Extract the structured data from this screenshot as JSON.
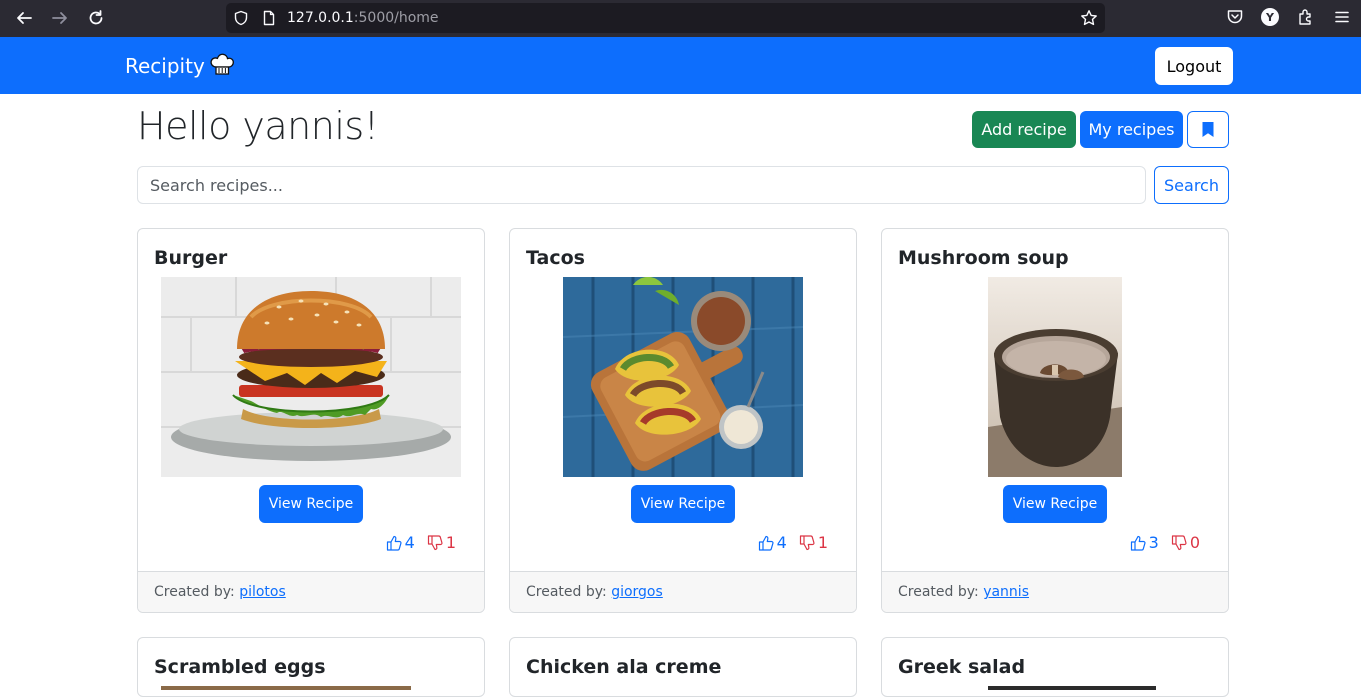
{
  "browser": {
    "url_host": "127.0.0.1",
    "url_path": ":5000/home",
    "profile_initial": "Y"
  },
  "navbar": {
    "brand": "Recipity",
    "logout_label": "Logout"
  },
  "header": {
    "greeting": "Hello yannis!",
    "add_recipe_label": "Add recipe",
    "my_recipes_label": "My recipes",
    "bookmark_icon": "bookmark-icon"
  },
  "search": {
    "placeholder": "Search recipes...",
    "value": "",
    "button_label": "Search"
  },
  "recipes": [
    {
      "title": "Burger",
      "view_label": "View Recipe",
      "likes": "4",
      "dislikes": "1",
      "created_by_label": "Created by:",
      "author": "pilotos"
    },
    {
      "title": "Tacos",
      "view_label": "View Recipe",
      "likes": "4",
      "dislikes": "1",
      "created_by_label": "Created by:",
      "author": "giorgos"
    },
    {
      "title": "Mushroom soup",
      "view_label": "View Recipe",
      "likes": "3",
      "dislikes": "0",
      "created_by_label": "Created by:",
      "author": "yannis"
    },
    {
      "title": "Scrambled eggs"
    },
    {
      "title": "Chicken ala creme"
    },
    {
      "title": "Greek salad"
    }
  ],
  "colors": {
    "primary": "#0d6efd",
    "success": "#198754",
    "danger": "#dc3545"
  }
}
